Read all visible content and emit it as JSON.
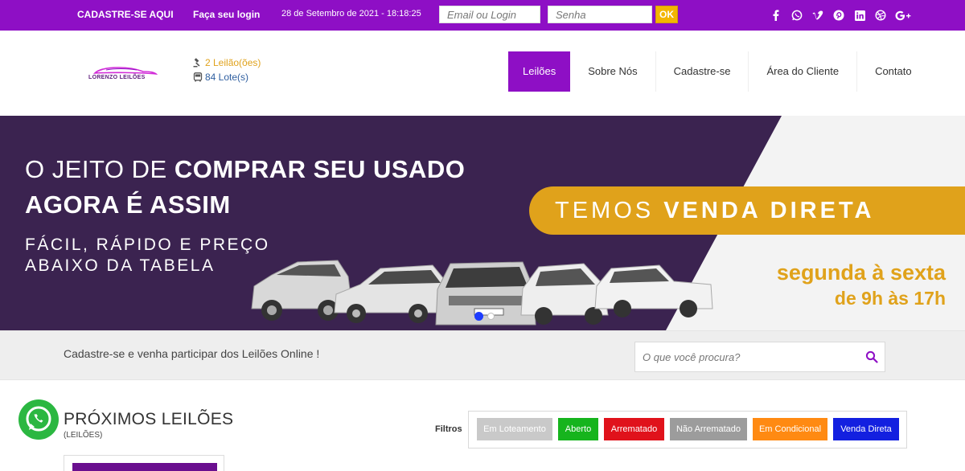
{
  "topbar": {
    "register_link": "CADASTRE-SE AQUI",
    "login_link": "Faça seu login",
    "datetime": "28 de Setembro de 2021 - 18:18:25",
    "email_placeholder": "Email ou Login",
    "password_placeholder": "Senha",
    "ok_label": "OK",
    "social": [
      "facebook-icon",
      "whatsapp-icon",
      "vimeo-icon",
      "pinterest-icon",
      "linkedin-icon",
      "dribbble-icon",
      "google-plus-icon"
    ]
  },
  "header": {
    "logo_text": "LORENZO LEILÕES",
    "auctions": "2 Leilão(ões)",
    "lots": "84 Lote(s)",
    "nav": [
      "Leilões",
      "Sobre Nós",
      "Cadastre-se",
      "Área do Cliente",
      "Contato"
    ],
    "active_nav": "Leilões"
  },
  "banner": {
    "headline_light": "O JEITO DE",
    "headline_bold_1": "COMPRAR SEU USADO",
    "headline_bold_2": "AGORA É ASSIM",
    "sub_line_1": "FÁCIL, RÁPIDO E PREÇO",
    "sub_line_2": "ABAIXO DA TABELA",
    "pill_light": "TEMOS",
    "pill_bold": "VENDA DIRETA",
    "schedule_1": "segunda à sexta",
    "schedule_2": "de 9h às 17h",
    "slides": 2,
    "active_slide": 1
  },
  "strip": {
    "message": "Cadastre-se e venha participar dos Leilões Online !",
    "search_placeholder": "O que você procura?"
  },
  "section": {
    "title": "PRÓXIMOS LEILÕES",
    "subtitle": "(LEILÕES)",
    "filters_label": "Filtros",
    "filters": [
      {
        "label": "Em Loteamento",
        "color": "#c9c9c9"
      },
      {
        "label": "Aberto",
        "color": "#16b41d"
      },
      {
        "label": "Arrematado",
        "color": "#e0121b"
      },
      {
        "label": "Não Arrematado",
        "color": "#9c9c9c"
      },
      {
        "label": "Em Condicional",
        "color": "#ff8a12"
      },
      {
        "label": "Venda Direta",
        "color": "#1320e0"
      }
    ]
  },
  "colors": {
    "brand_purple": "#8e0fc5",
    "banner_purple": "#3b2350",
    "accent_gold": "#e0a21b"
  }
}
